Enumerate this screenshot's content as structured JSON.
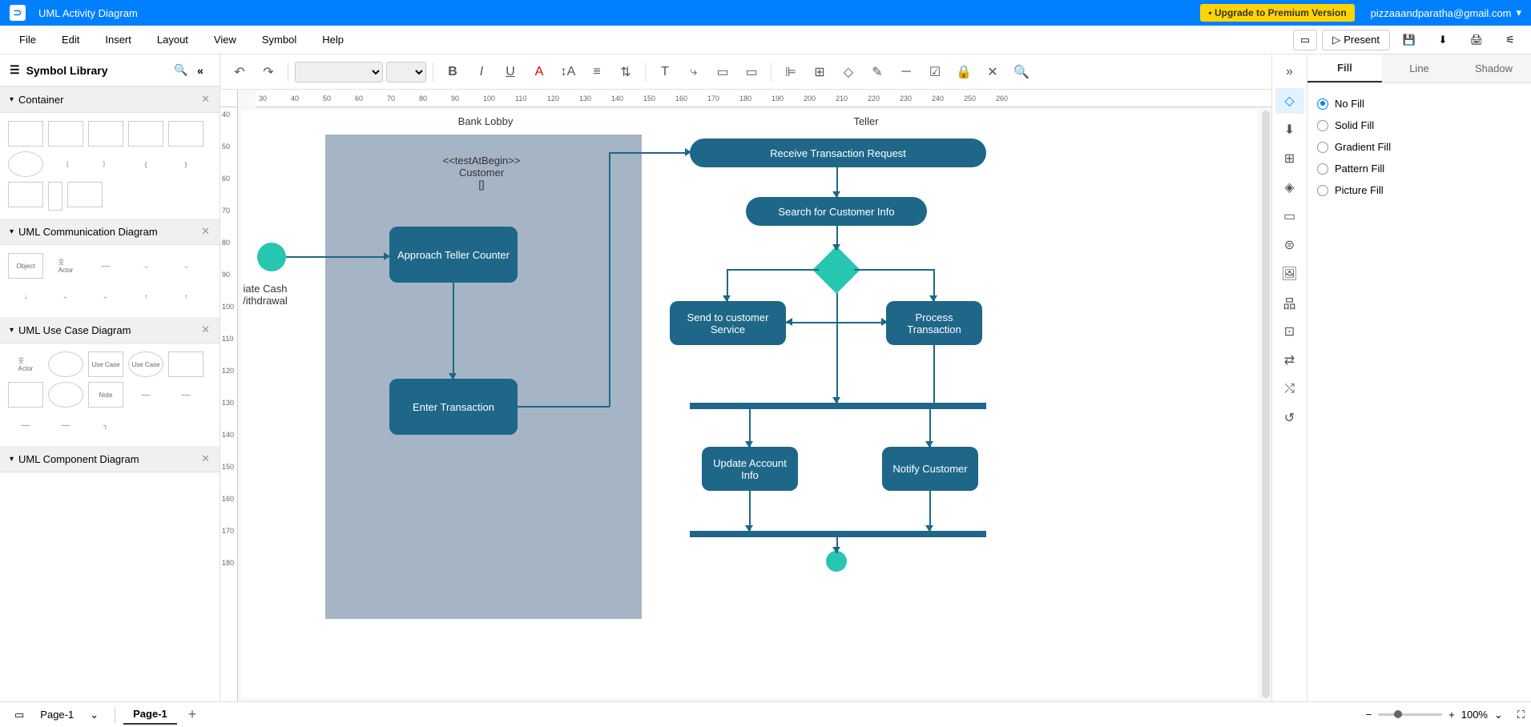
{
  "titleBar": {
    "appTitle": "UML Activity Diagram",
    "upgradeLabel": "• Upgrade to Premium Version",
    "userEmail": "pizzaaandparatha@gmail.com"
  },
  "menuBar": {
    "items": [
      "File",
      "Edit",
      "Insert",
      "Layout",
      "View",
      "Symbol",
      "Help"
    ],
    "presentLabel": "Present"
  },
  "symbolLibrary": {
    "title": "Symbol Library",
    "categories": [
      {
        "name": "Container"
      },
      {
        "name": "UML Communication Diagram"
      },
      {
        "name": "UML Use Case Diagram"
      },
      {
        "name": "UML Component Diagram"
      }
    ]
  },
  "rightPanel": {
    "tabs": [
      "Fill",
      "Line",
      "Shadow"
    ],
    "activeTab": "Fill",
    "fillOptions": [
      "No Fill",
      "Solid Fill",
      "Gradient Fill",
      "Pattern Fill",
      "Picture Fill"
    ],
    "selectedFill": "No Fill"
  },
  "canvas": {
    "swimlanes": [
      "Bank Lobby",
      "Teller"
    ],
    "objectNode": {
      "line1": "<<testAtBegin>>",
      "line2": "Customer",
      "line3": "[]"
    },
    "partialText": {
      "line1": "iate Cash",
      "line2": "/ithdrawal"
    },
    "nodes": {
      "approachTeller": "Approach Teller Counter",
      "enterTransaction": "Enter Transaction",
      "receiveRequest": "Receive Transaction Request",
      "searchCustomer": "Search for Customer Info",
      "sendService": "Send to customer Service",
      "processTransaction": "Process Transaction",
      "updateAccount": "Update Account Info",
      "notifyCustomer": "Notify Customer"
    }
  },
  "bottomBar": {
    "pageDropdown": "Page-1",
    "pageTab": "Page-1",
    "zoom": "100%"
  },
  "rulerH": [
    "30",
    "40",
    "50",
    "60",
    "70",
    "80",
    "90",
    "100",
    "110",
    "120",
    "130",
    "140",
    "150",
    "160",
    "170",
    "180",
    "190",
    "200",
    "210",
    "220",
    "230",
    "240",
    "250",
    "260"
  ],
  "rulerV": [
    "40",
    "50",
    "60",
    "70",
    "80",
    "90",
    "100",
    "110",
    "120",
    "130",
    "140",
    "150",
    "160",
    "170",
    "180"
  ]
}
